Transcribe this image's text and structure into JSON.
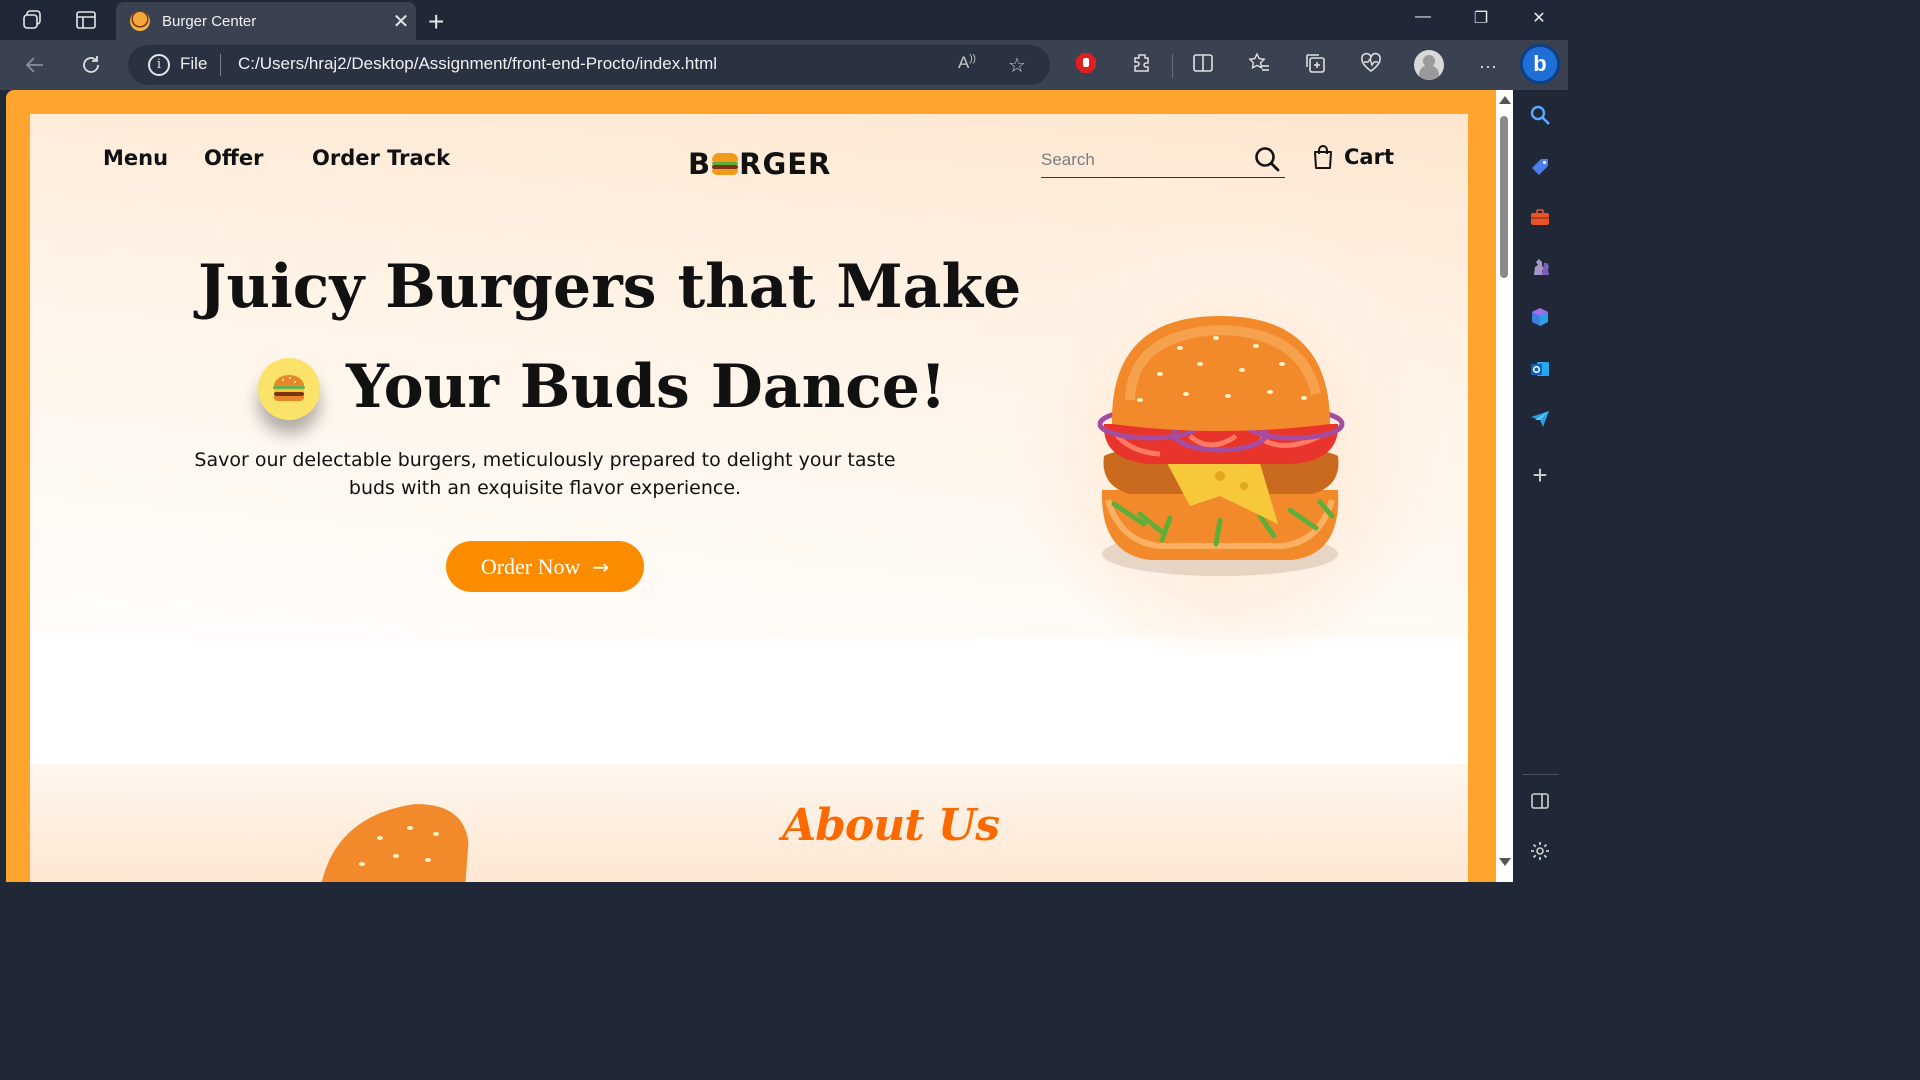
{
  "browser": {
    "tab": {
      "title": "Burger Center",
      "close": "✕"
    },
    "new_tab": "+",
    "window_controls": {
      "minimize": "—",
      "restore": "❐",
      "close": "✕"
    },
    "address": {
      "scheme_label": "File",
      "url": "C:/Users/hraj2/Desktop/Assignment/front-end-Procto/index.html"
    }
  },
  "nav": {
    "links": [
      "Menu",
      "Offer",
      "Order Track"
    ],
    "logo": {
      "left": "B",
      "right": "RGER"
    },
    "search": {
      "placeholder": "Search",
      "value": ""
    },
    "cart_label": "Cart"
  },
  "hero": {
    "headline_line1": "Juicy Burgers that Make",
    "headline_line2": "Your Buds Dance!",
    "tagline": "Savor our delectable burgers, meticulously prepared to delight your taste buds with an exquisite flavor experience.",
    "cta": {
      "label": "Order Now",
      "arrow": "→"
    }
  },
  "about": {
    "title": "About Us"
  },
  "colors": {
    "accent": "#fb8c00",
    "frame": "#ffa42d",
    "about_title": "#fb6a00",
    "chrome_dark": "#202837",
    "chrome_mid": "#3a4150"
  },
  "icons": {
    "tabstrip": [
      "workspaces-icon",
      "tab-actions-icon"
    ],
    "toolbar": [
      "read-aloud-icon",
      "favorite-star-icon",
      "adblock-icon",
      "extensions-icon",
      "split-screen-icon",
      "favorites-icon",
      "collections-icon",
      "browser-essentials-icon",
      "settings-more-icon"
    ],
    "sidebar": [
      "search-icon",
      "shopping-tag-icon",
      "tools-icon",
      "games-icon",
      "copilot-icon",
      "outlook-icon",
      "drop-icon",
      "add-icon",
      "sidebar-toggle-icon",
      "settings-icon"
    ]
  }
}
